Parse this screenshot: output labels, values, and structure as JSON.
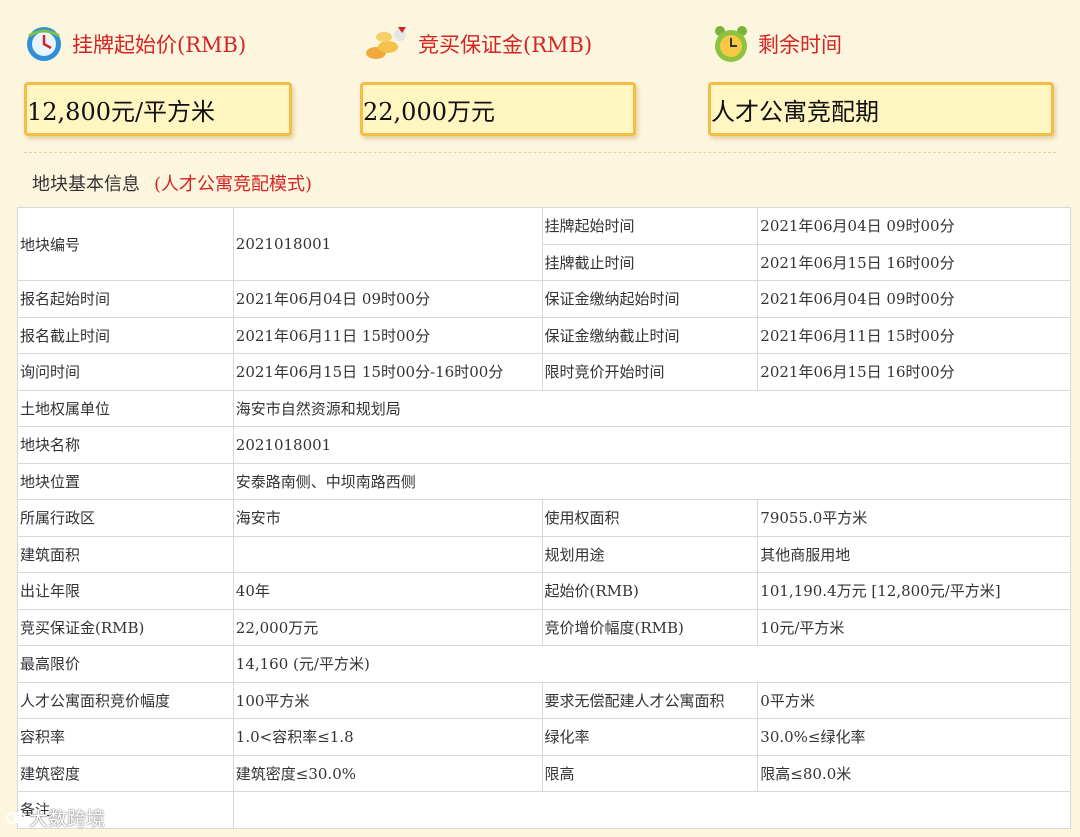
{
  "header": {
    "price_label": "挂牌起始价(RMB)",
    "deposit_label": "竞买保证金(RMB)",
    "time_label": "剩余时间",
    "price_value": "12,800元/平方米",
    "deposit_value": "22,000万元",
    "time_value": "人才公寓竞配期"
  },
  "section": {
    "title": "地块基本信息",
    "mode": "(人才公寓竞配模式)"
  },
  "table": {
    "r0": {
      "k1": "地块编号",
      "v1": "2021018001",
      "k2": "挂牌起始时间",
      "v2": "2021年06月04日 09时00分"
    },
    "r1": {
      "k2": "挂牌截止时间",
      "v2": "2021年06月15日 16时00分"
    },
    "r2": {
      "k1": "报名起始时间",
      "v1": "2021年06月04日 09时00分",
      "k2": "保证金缴纳起始时间",
      "v2": "2021年06月04日 09时00分"
    },
    "r3": {
      "k1": "报名截止时间",
      "v1": "2021年06月11日 15时00分",
      "k2": "保证金缴纳截止时间",
      "v2": "2021年06月11日 15时00分"
    },
    "r4": {
      "k1": "询问时间",
      "v1": "2021年06月15日 15时00分-16时00分",
      "k2": "限时竞价开始时间",
      "v2": "2021年06月15日 16时00分"
    },
    "r5": {
      "k1": "土地权属单位",
      "v1": "海安市自然资源和规划局"
    },
    "r6": {
      "k1": "地块名称",
      "v1": "2021018001"
    },
    "r7": {
      "k1": "地块位置",
      "v1": "安泰路南侧、中坝南路西侧"
    },
    "r8": {
      "k1": "所属行政区",
      "v1": "海安市",
      "k2": "使用权面积",
      "v2": "79055.0平方米"
    },
    "r9": {
      "k1": "建筑面积",
      "v1": "",
      "k2": "规划用途",
      "v2": "其他商服用地"
    },
    "r10": {
      "k1": "出让年限",
      "v1": "40年",
      "k2": "起始价(RMB)",
      "v2": "101,190.4万元 [12,800元/平方米]"
    },
    "r11": {
      "k1": "竞买保证金(RMB)",
      "v1": "22,000万元",
      "k2": "竞价增价幅度(RMB)",
      "v2": "10元/平方米"
    },
    "r12": {
      "k1": "最高限价",
      "v1": "14,160 (元/平方米)"
    },
    "r13": {
      "k1": "人才公寓面积竞价幅度",
      "v1": "100平方米",
      "k2": "要求无偿配建人才公寓面积",
      "v2": "0平方米"
    },
    "r14": {
      "k1": "容积率",
      "v1": "1.0<容积率≤1.8",
      "k2": "绿化率",
      "v2": "30.0%≤绿化率"
    },
    "r15": {
      "k1": "建筑密度",
      "v1": "建筑密度≤30.0%",
      "k2": "限高",
      "v2": "限高≤80.0米"
    },
    "r16": {
      "k1": "备注",
      "v1": ""
    }
  },
  "watermark": "大数跨境",
  "icons": {
    "price": "globe-clock-icon",
    "deposit": "coins-icon",
    "time": "alarm-clock-icon"
  }
}
